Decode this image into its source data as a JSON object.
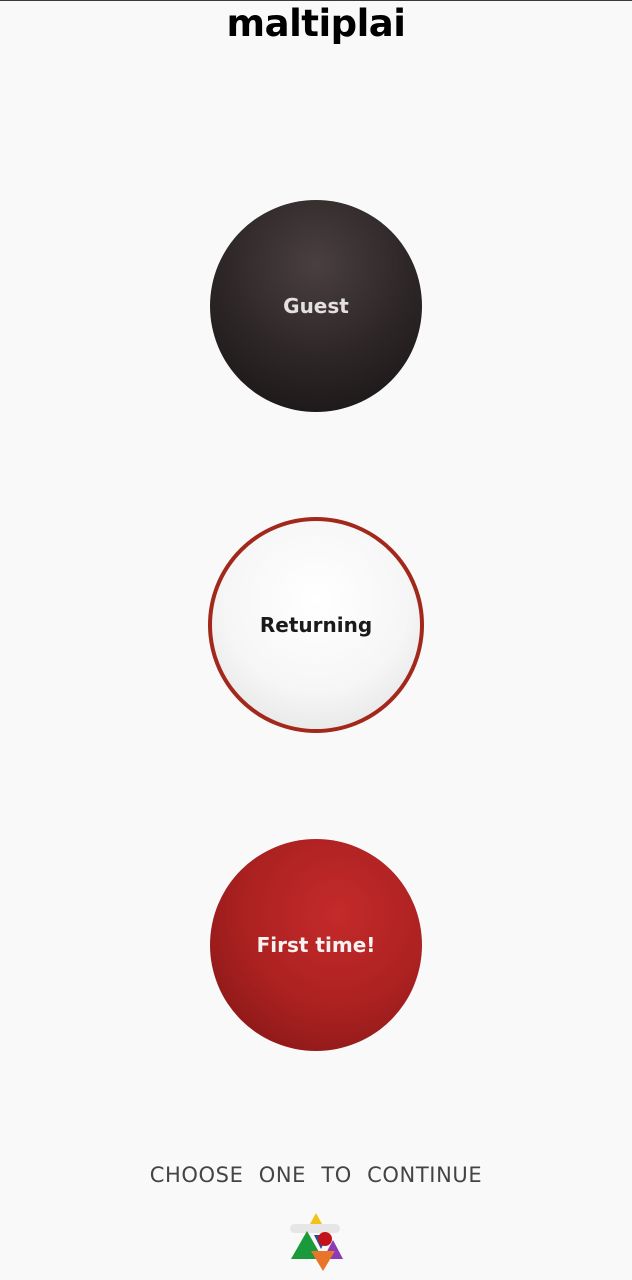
{
  "app": {
    "title": "maltiplai"
  },
  "options": {
    "guest_label": "Guest",
    "returning_label": "Returning",
    "first_time_label": "First time!"
  },
  "footer": {
    "prompt": "CHOOSE ONE TO CONTINUE",
    "logo_icon": "brand-logo-icon"
  },
  "colors": {
    "guest": "#2e2728",
    "returning_border": "#a3281c",
    "first_time": "#ac2121",
    "background": "#f9f9f9"
  }
}
